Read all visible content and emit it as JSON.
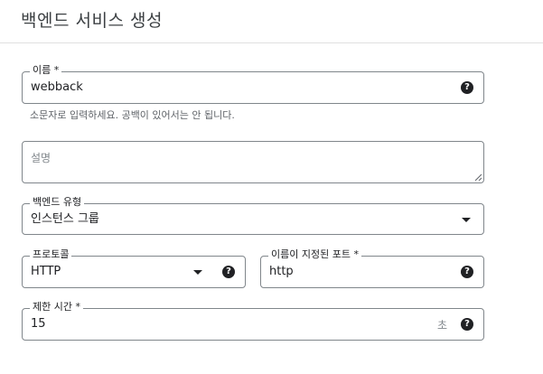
{
  "page": {
    "title": "백엔드 서비스 생성"
  },
  "name_field": {
    "label": "이름 *",
    "value": "webback",
    "hint": "소문자로 입력하세요. 공백이 있어서는 안 됩니다.",
    "help_icon": "help-icon"
  },
  "description_field": {
    "placeholder": "설명"
  },
  "backend_type": {
    "label": "백엔드 유형",
    "selected": "인스턴스 그룹",
    "icon": "dropdown-arrow-icon"
  },
  "protocol": {
    "label": "프로토콜",
    "selected": "HTTP",
    "icon": "dropdown-arrow-icon",
    "help_icon": "help-icon"
  },
  "named_port": {
    "label": "이름이 지정된 포트 *",
    "value": "http",
    "help_icon": "help-icon"
  },
  "timeout": {
    "label": "제한 시간 *",
    "value": "15",
    "unit": "초",
    "help_icon": "help-icon"
  },
  "colors": {
    "text": "#202124",
    "border": "#80868b",
    "muted": "#5f6368"
  }
}
